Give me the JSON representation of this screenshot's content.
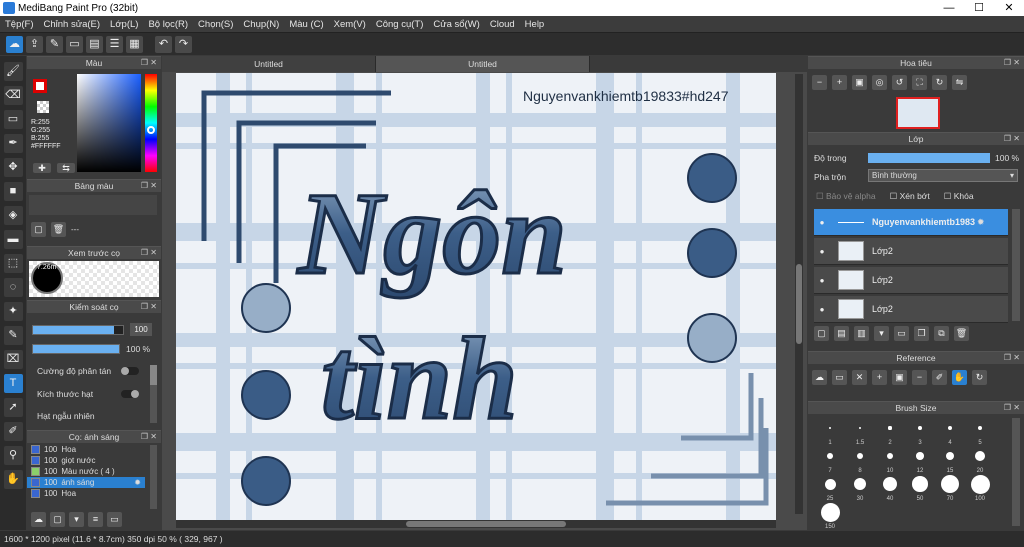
{
  "window": {
    "title": "MediBang Paint Pro (32bit)",
    "minimize": "—",
    "maximize": "☐",
    "close": "✕"
  },
  "menu": [
    "Tệp(F)",
    "Chỉnh sửa(E)",
    "Lớp(L)",
    "Bộ lọc(R)",
    "Chọn(S)",
    "Chụp(N)",
    "Màu (C)",
    "Xem(V)",
    "Công cụ(T)",
    "Cửa sổ(W)",
    "Cloud",
    "Help"
  ],
  "toolbar_icons": [
    "cloud-icon",
    "share-icon",
    "comment-icon",
    "page-icon",
    "document-icon",
    "list-icon",
    "grid-icon",
    "undo-icon",
    "redo-icon"
  ],
  "tools": [
    "brush-icon",
    "eraser-icon",
    "rect-icon",
    "pen-icon",
    "move-icon",
    "fill-shape-icon",
    "bucket-icon",
    "gradient-icon",
    "select-rect-icon",
    "lasso-icon",
    "magic-wand-icon",
    "select-pen-icon",
    "select-eraser-icon",
    "text-icon",
    "operation-icon",
    "eyedropper-icon",
    "dropper-icon",
    "hand-icon"
  ],
  "color_panel": {
    "title": "Màu",
    "r": "R:255",
    "g": "G:255",
    "b": "B:255",
    "hex": "#FFFFFF"
  },
  "palette_panel": {
    "title": "Bảng màu",
    "placeholder": "---"
  },
  "preview_panel": {
    "title": "Xem trước cọ",
    "size": "7.26m"
  },
  "control_panel": {
    "title": "Kiểm soát cọ",
    "size_value": "100",
    "opacity_value": "100 %",
    "size_fraction": 0.9,
    "opacity_fraction": 1.0,
    "opt1": "Cường độ phân tán",
    "opt2": "Kích thước hạt",
    "opt3": "Hạt ngẫu nhiên"
  },
  "brush_panel": {
    "title": "Cọ: ánh sáng",
    "items": [
      {
        "size": "100",
        "name": "Hoa"
      },
      {
        "size": "100",
        "name": "giọt nước"
      },
      {
        "size": "100",
        "name": "Màu nước ( 4 )"
      },
      {
        "size": "100",
        "name": "ánh sáng"
      },
      {
        "size": "100",
        "name": "Hoa"
      }
    ]
  },
  "tabs": [
    "Untitled",
    "Untitled"
  ],
  "artwork": {
    "watermark": "Nguyenvankhiemtb19833#hd247",
    "word1": "Ngôn",
    "word2": "tình"
  },
  "navigator": {
    "title": "Hoa tiêu"
  },
  "layers": {
    "title": "Lớp",
    "opacity_label": "Độ trong",
    "opacity_value": "100 %",
    "opacity_fraction": 1.0,
    "blend_label": "Pha trộn",
    "blend_value": "Bình thường",
    "protect_alpha": "Bảo vệ alpha",
    "clip": "Xén bớt",
    "lock": "Khóa",
    "rows": [
      {
        "name": "Nguyenvankhiemtb1983",
        "selected": true
      },
      {
        "name": "Lớp2",
        "selected": false
      },
      {
        "name": "Lớp2",
        "selected": false
      },
      {
        "name": "Lớp2",
        "selected": false
      }
    ]
  },
  "reference": {
    "title": "Reference"
  },
  "brush_size": {
    "title": "Brush Size",
    "sizes": [
      "1",
      "1.5",
      "2",
      "3",
      "4",
      "5",
      "7",
      "8",
      "10",
      "12",
      "15",
      "20",
      "25",
      "30",
      "40",
      "50",
      "70",
      "100",
      "150"
    ]
  },
  "status": {
    "text": "1600 * 1200 pixel  (11.6 * 8.7cm)  350 dpi  50 %  ( 329, 967 )"
  }
}
